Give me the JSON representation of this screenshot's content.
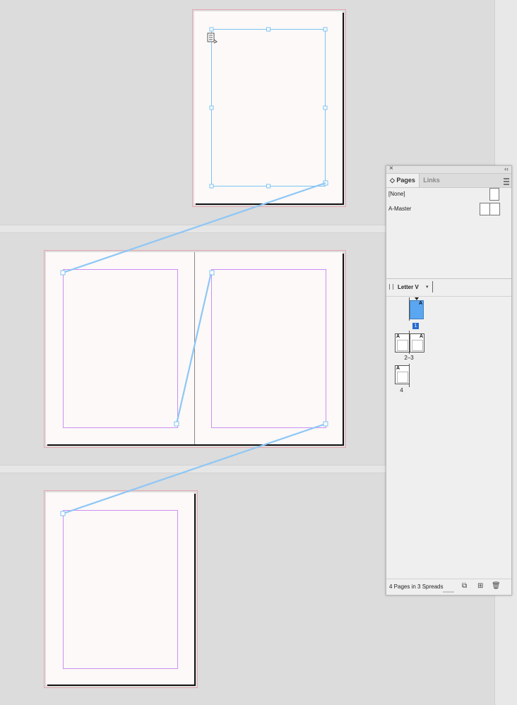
{
  "panel": {
    "close_icon": "×",
    "collapse_icon": "‹‹",
    "tabs": [
      {
        "label": "◇ Pages",
        "active": true
      },
      {
        "label": "Links",
        "active": false
      }
    ],
    "masters": [
      {
        "label": "[None]"
      },
      {
        "label": "A-Master"
      }
    ],
    "page_size_label": "Letter V",
    "page_size_chevron": "▾",
    "spreads": [
      {
        "label": "1",
        "selected": true,
        "master_letters": [
          "A"
        ]
      },
      {
        "label": "2–3",
        "selected": false,
        "master_letters": [
          "A",
          "A"
        ]
      },
      {
        "label": "4",
        "selected": false,
        "master_letters": [
          "A"
        ]
      }
    ],
    "footer_text": "4 Pages in 3 Spreads",
    "footer_icons": {
      "edit_size": "⧉",
      "new_page": "⊞",
      "delete": "🗑"
    }
  },
  "colors": {
    "thread": "#8ec7f5",
    "frame": "#7cc3f2",
    "margin": "#cc8ff5",
    "bleed": "#e6a7b0",
    "selected_page": "#5aa6f0"
  }
}
